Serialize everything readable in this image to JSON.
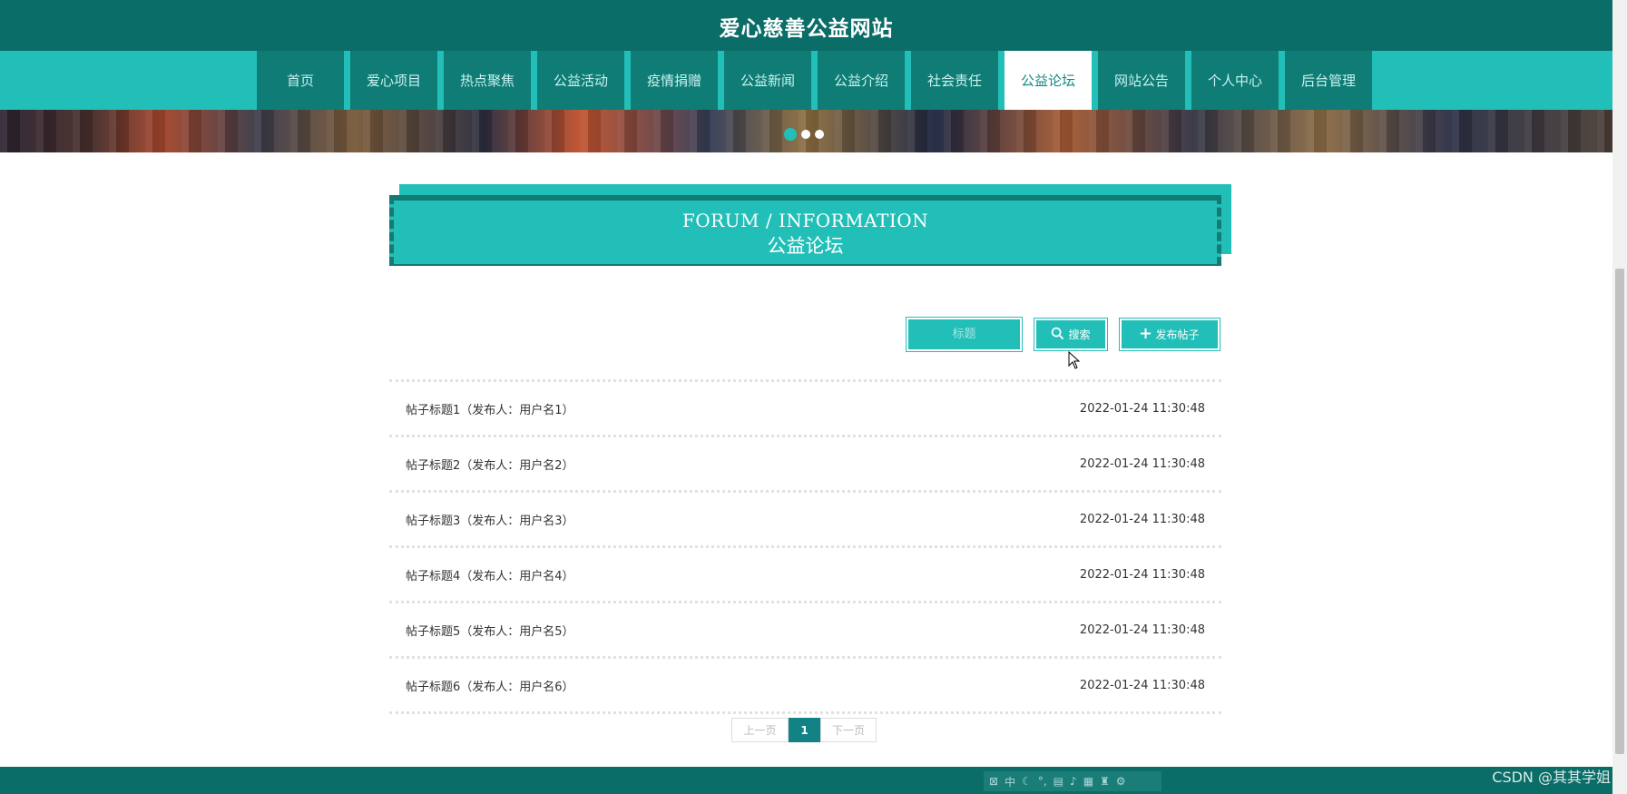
{
  "site": {
    "title": "爱心慈善公益网站"
  },
  "nav": {
    "items": [
      {
        "label": "首页",
        "active": false
      },
      {
        "label": "爱心项目",
        "active": false
      },
      {
        "label": "热点聚焦",
        "active": false
      },
      {
        "label": "公益活动",
        "active": false
      },
      {
        "label": "疫情捐赠",
        "active": false
      },
      {
        "label": "公益新闻",
        "active": false
      },
      {
        "label": "公益介绍",
        "active": false
      },
      {
        "label": "社会责任",
        "active": false
      },
      {
        "label": "公益论坛",
        "active": true
      },
      {
        "label": "网站公告",
        "active": false
      },
      {
        "label": "个人中心",
        "active": false
      },
      {
        "label": "后台管理",
        "active": false
      }
    ]
  },
  "banner": {
    "dot_count": 3,
    "active_dot": 0
  },
  "section": {
    "title_en": "FORUM / INFORMATION",
    "title_cn": "公益论坛"
  },
  "search": {
    "placeholder": "标题",
    "value": ""
  },
  "buttons": {
    "search_label": "搜索",
    "post_label": "发布帖子"
  },
  "posts": [
    {
      "title": "帖子标题1（发布人：用户名1）",
      "time": "2022-01-24 11:30:48"
    },
    {
      "title": "帖子标题2（发布人：用户名2）",
      "time": "2022-01-24 11:30:48"
    },
    {
      "title": "帖子标题3（发布人：用户名3）",
      "time": "2022-01-24 11:30:48"
    },
    {
      "title": "帖子标题4（发布人：用户名4）",
      "time": "2022-01-24 11:30:48"
    },
    {
      "title": "帖子标题5（发布人：用户名5）",
      "time": "2022-01-24 11:30:48"
    },
    {
      "title": "帖子标题6（发布人：用户名6）",
      "time": "2022-01-24 11:30:48"
    }
  ],
  "pagination": {
    "prev": "上一页",
    "current": "1",
    "next": "下一页"
  },
  "ime": {
    "mode": "中"
  },
  "watermark": "CSDN @其其学姐",
  "colors": {
    "primary": "#22bfb8",
    "dark": "#0b6d68",
    "nav_item": "#0f7c75",
    "page_active": "#138285"
  }
}
